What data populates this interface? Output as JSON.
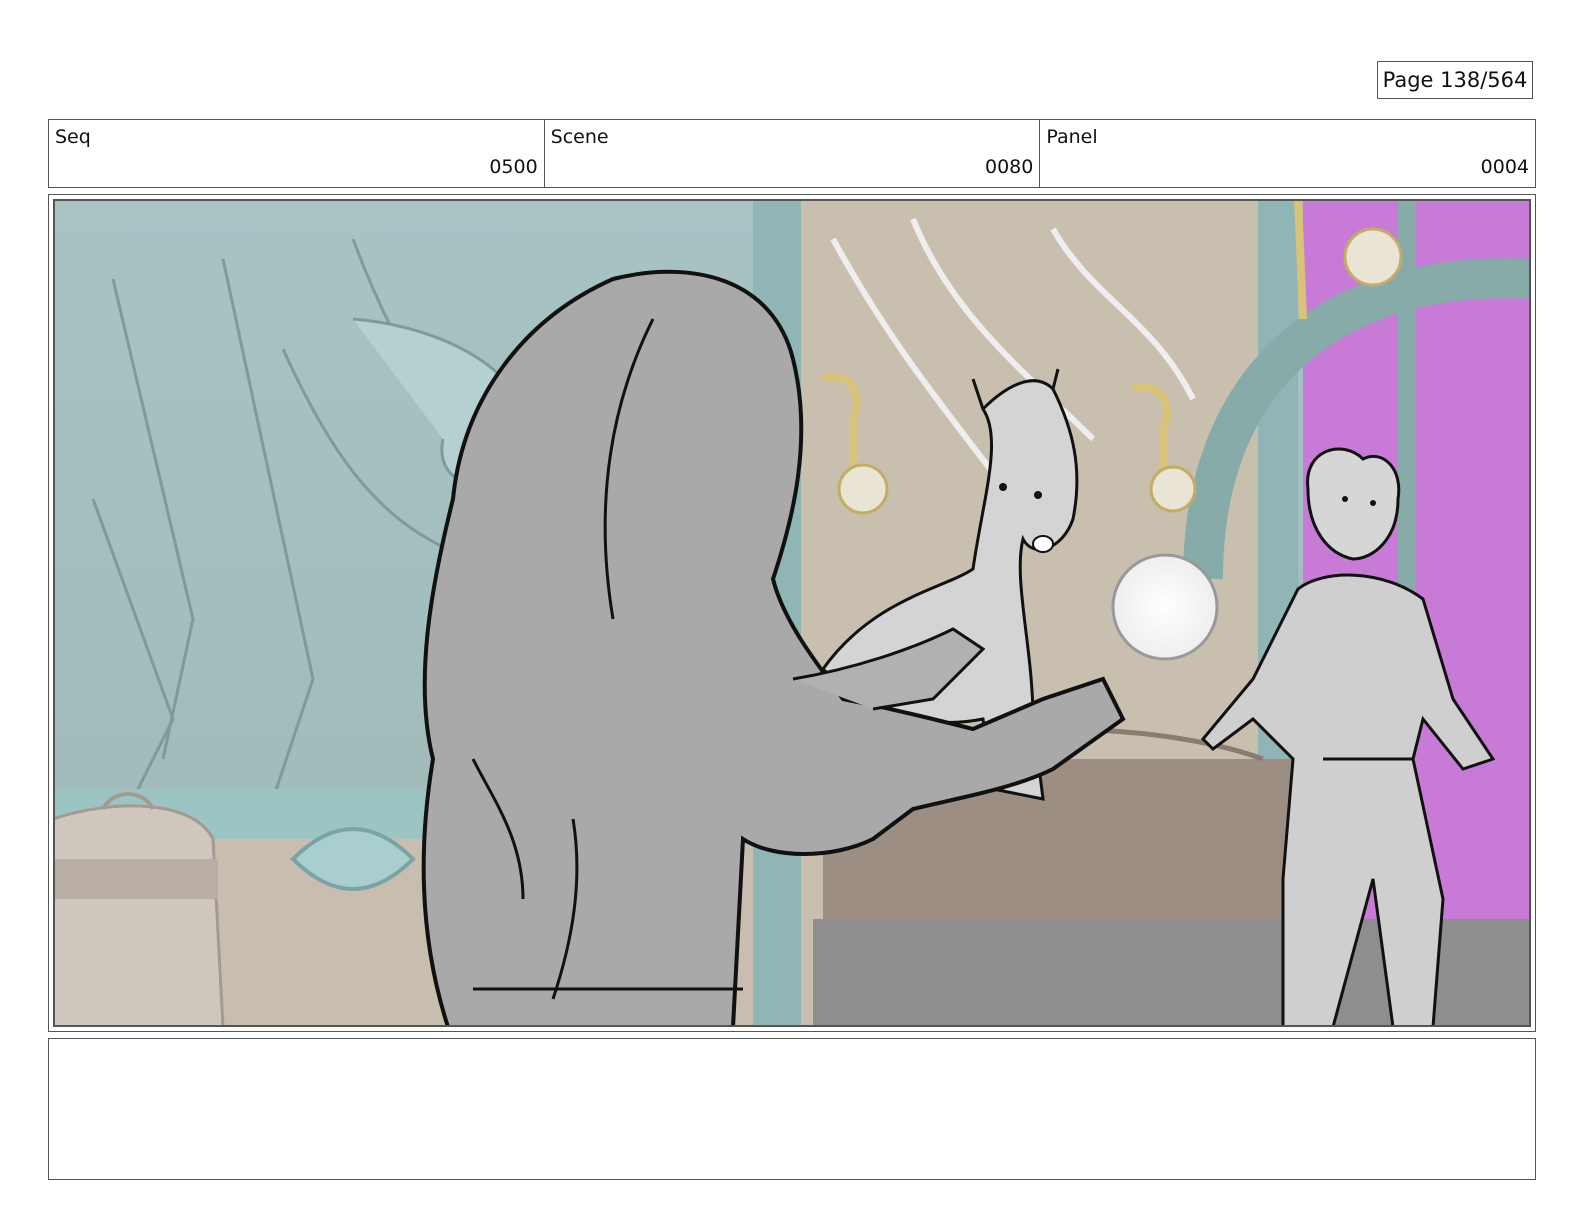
{
  "page": {
    "label": "Page 138/564"
  },
  "header": {
    "seq": {
      "label": "Seq",
      "value": "0500"
    },
    "scene": {
      "label": "Scene",
      "value": "0080"
    },
    "panel": {
      "label": "Panel",
      "value": "0004"
    }
  },
  "notes": {
    "text": ""
  },
  "colors": {
    "wall": "#a9c4c4",
    "floor": "#8e8e8e",
    "magenta_window": "#c77bd6",
    "sketch_fill": "#b8b8b8",
    "lamp_gold": "#d9c27a"
  }
}
